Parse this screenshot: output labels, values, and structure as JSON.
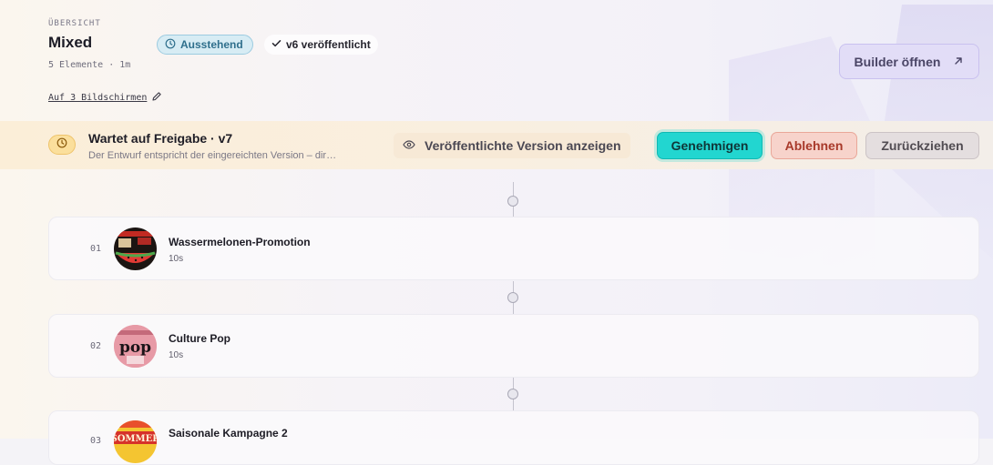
{
  "header": {
    "eyebrow": "ÜBERSICHT",
    "title": "Mixed",
    "meta": "5 Elemente · 1m",
    "status_badge": "Ausstehend",
    "published_badge": "v6 veröffentlicht",
    "screens_link": "Auf 3 Bildschirmen",
    "builder_button": "Builder öffnen"
  },
  "approval": {
    "title": "Wartet auf Freigabe · v7",
    "subtitle": "Der Entwurf entspricht der eingereichten Version – dir…",
    "view_published": "Veröffentlichte Version anzeigen",
    "approve": "Genehmigen",
    "reject": "Ablehnen",
    "withdraw": "Zurückziehen"
  },
  "items": [
    {
      "num": "01",
      "name": "Wassermelonen-Promotion",
      "duration": "10s"
    },
    {
      "num": "02",
      "name": "Culture Pop",
      "duration": "10s"
    },
    {
      "num": "03",
      "name": "Saisonale Kampagne 2",
      "duration": ""
    }
  ],
  "thumb_text": {
    "item2": "pop",
    "item3": "SOMMER"
  },
  "icons": {
    "status": "clock-icon",
    "published": "check-icon",
    "edit": "pencil-icon",
    "external": "arrow-up-right-icon",
    "approval": "clock-icon",
    "view": "eye-icon"
  },
  "colors": {
    "approve": "#22d6d0",
    "reject": "#f7d3cb",
    "pending_badge": "#d7ecf4",
    "builder": "#e2ddf7"
  }
}
